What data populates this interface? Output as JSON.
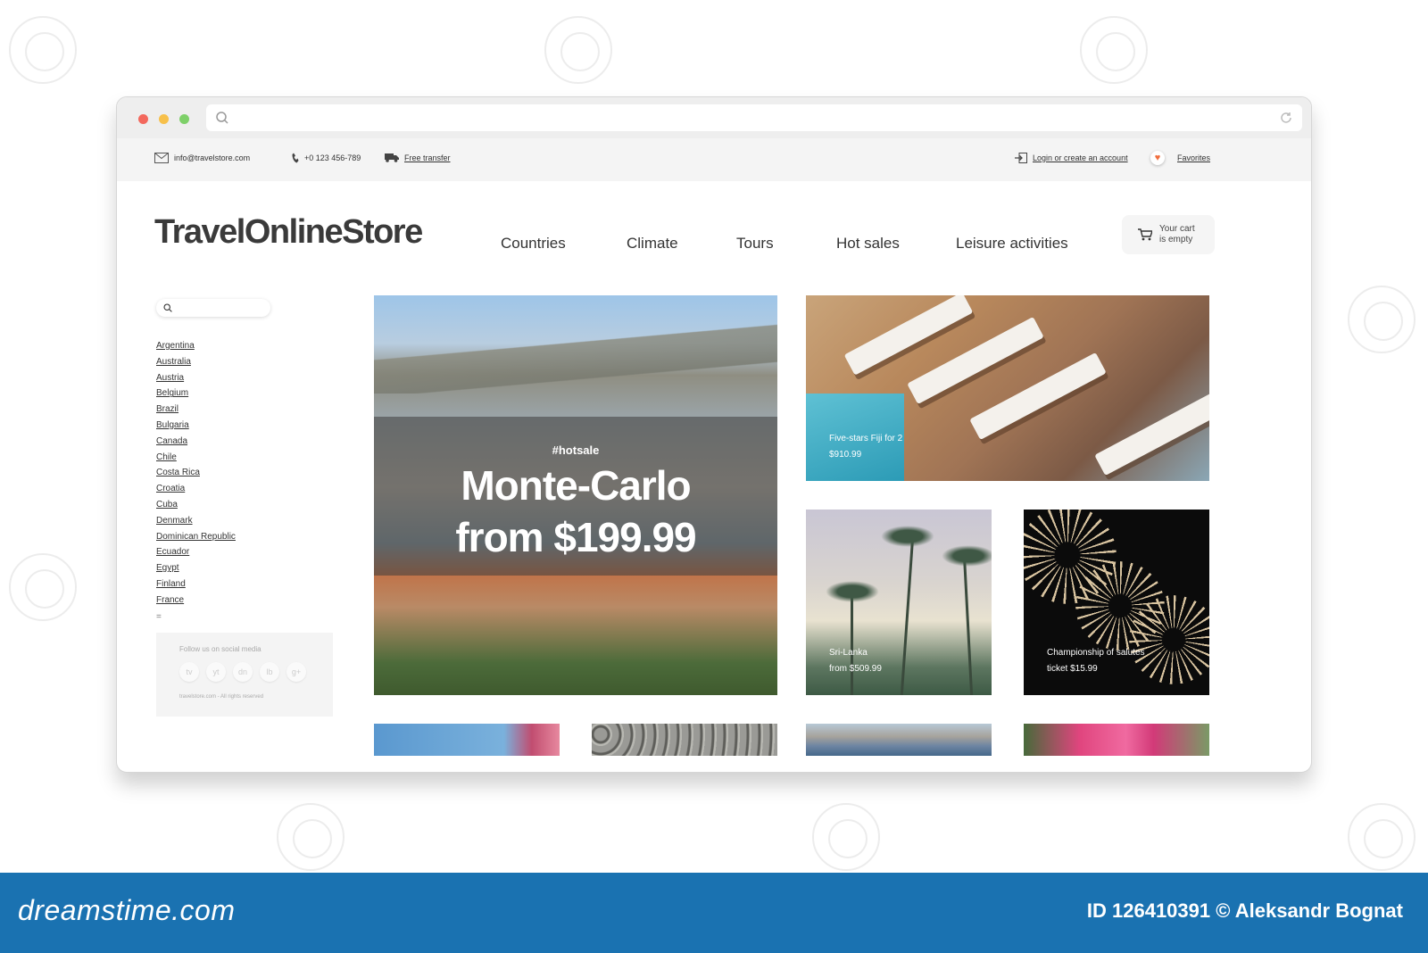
{
  "topbar": {
    "email": "info@travelstore.com",
    "phone": "+0 123 456-789",
    "transfer": "Free transfer",
    "login": "Login or create an account",
    "favorites": "Favorites"
  },
  "header": {
    "logo": "TravelOnlineStore",
    "nav": [
      "Countries",
      "Climate",
      "Tours",
      "Hot sales",
      "Leisure activities"
    ],
    "cart_line1": "Your cart",
    "cart_line2": "is empty"
  },
  "sidebar": {
    "countries": [
      "Argentina",
      "Australia",
      "Austria",
      "Belgium",
      "Brazil",
      "Bulgaria",
      "Canada",
      "Chile",
      "Costa Rica",
      "Croatia",
      "Cuba",
      "Denmark",
      "Dominican Republic",
      "Ecuador",
      "Egypt",
      "Finland",
      "France"
    ],
    "more": "="
  },
  "social": {
    "title": "Follow us on social media",
    "icons": [
      "tv",
      "yt",
      "dn",
      "lb",
      "g+"
    ],
    "copyright": "travelstore.com - All rights reserved"
  },
  "hero": {
    "tag": "#hotsale",
    "title_line1": "Monte-Carlo",
    "title_line2": "from $199.99"
  },
  "tiles": {
    "loungers": {
      "line1": "Five-stars Fiji for 2",
      "line2": "$910.99"
    },
    "palms": {
      "line1": "Sri-Lanka",
      "line2": "from $509.99"
    },
    "fireworks": {
      "line1": "Championship of salutes",
      "line2": "ticket $15.99"
    }
  },
  "banner": {
    "brand": "dreamstime.com",
    "credit": "ID 126410391 © Aleksandr  Bognat"
  },
  "colors": {
    "banner": "#1a72b1",
    "heart": "#f06d3c"
  }
}
